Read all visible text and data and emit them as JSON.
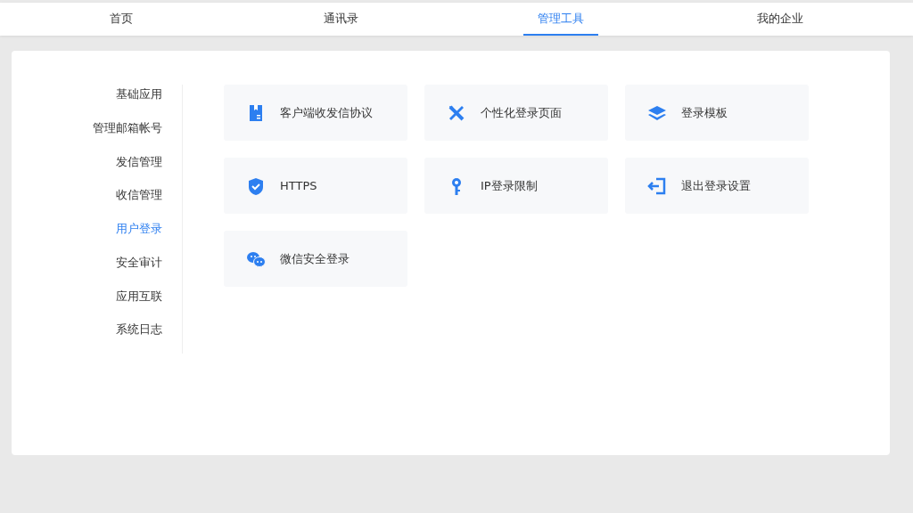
{
  "tabs": [
    {
      "label": "首页",
      "selected": false
    },
    {
      "label": "通讯录",
      "selected": false
    },
    {
      "label": "管理工具",
      "selected": true
    },
    {
      "label": "我的企业",
      "selected": false
    }
  ],
  "sidebar": {
    "items": [
      {
        "label": "基础应用",
        "selected": false
      },
      {
        "label": "管理邮箱帐号",
        "selected": false
      },
      {
        "label": "发信管理",
        "selected": false
      },
      {
        "label": "收信管理",
        "selected": false
      },
      {
        "label": "用户登录",
        "selected": true
      },
      {
        "label": "安全审计",
        "selected": false
      },
      {
        "label": "应用互联",
        "selected": false
      },
      {
        "label": "系统日志",
        "selected": false
      }
    ]
  },
  "tiles": [
    {
      "label": "客户端收发信协议"
    },
    {
      "label": "个性化登录页面"
    },
    {
      "label": "登录模板"
    },
    {
      "label": "HTTPS"
    },
    {
      "label": "IP登录限制"
    },
    {
      "label": "退出登录设置"
    },
    {
      "label": "微信安全登录"
    }
  ]
}
